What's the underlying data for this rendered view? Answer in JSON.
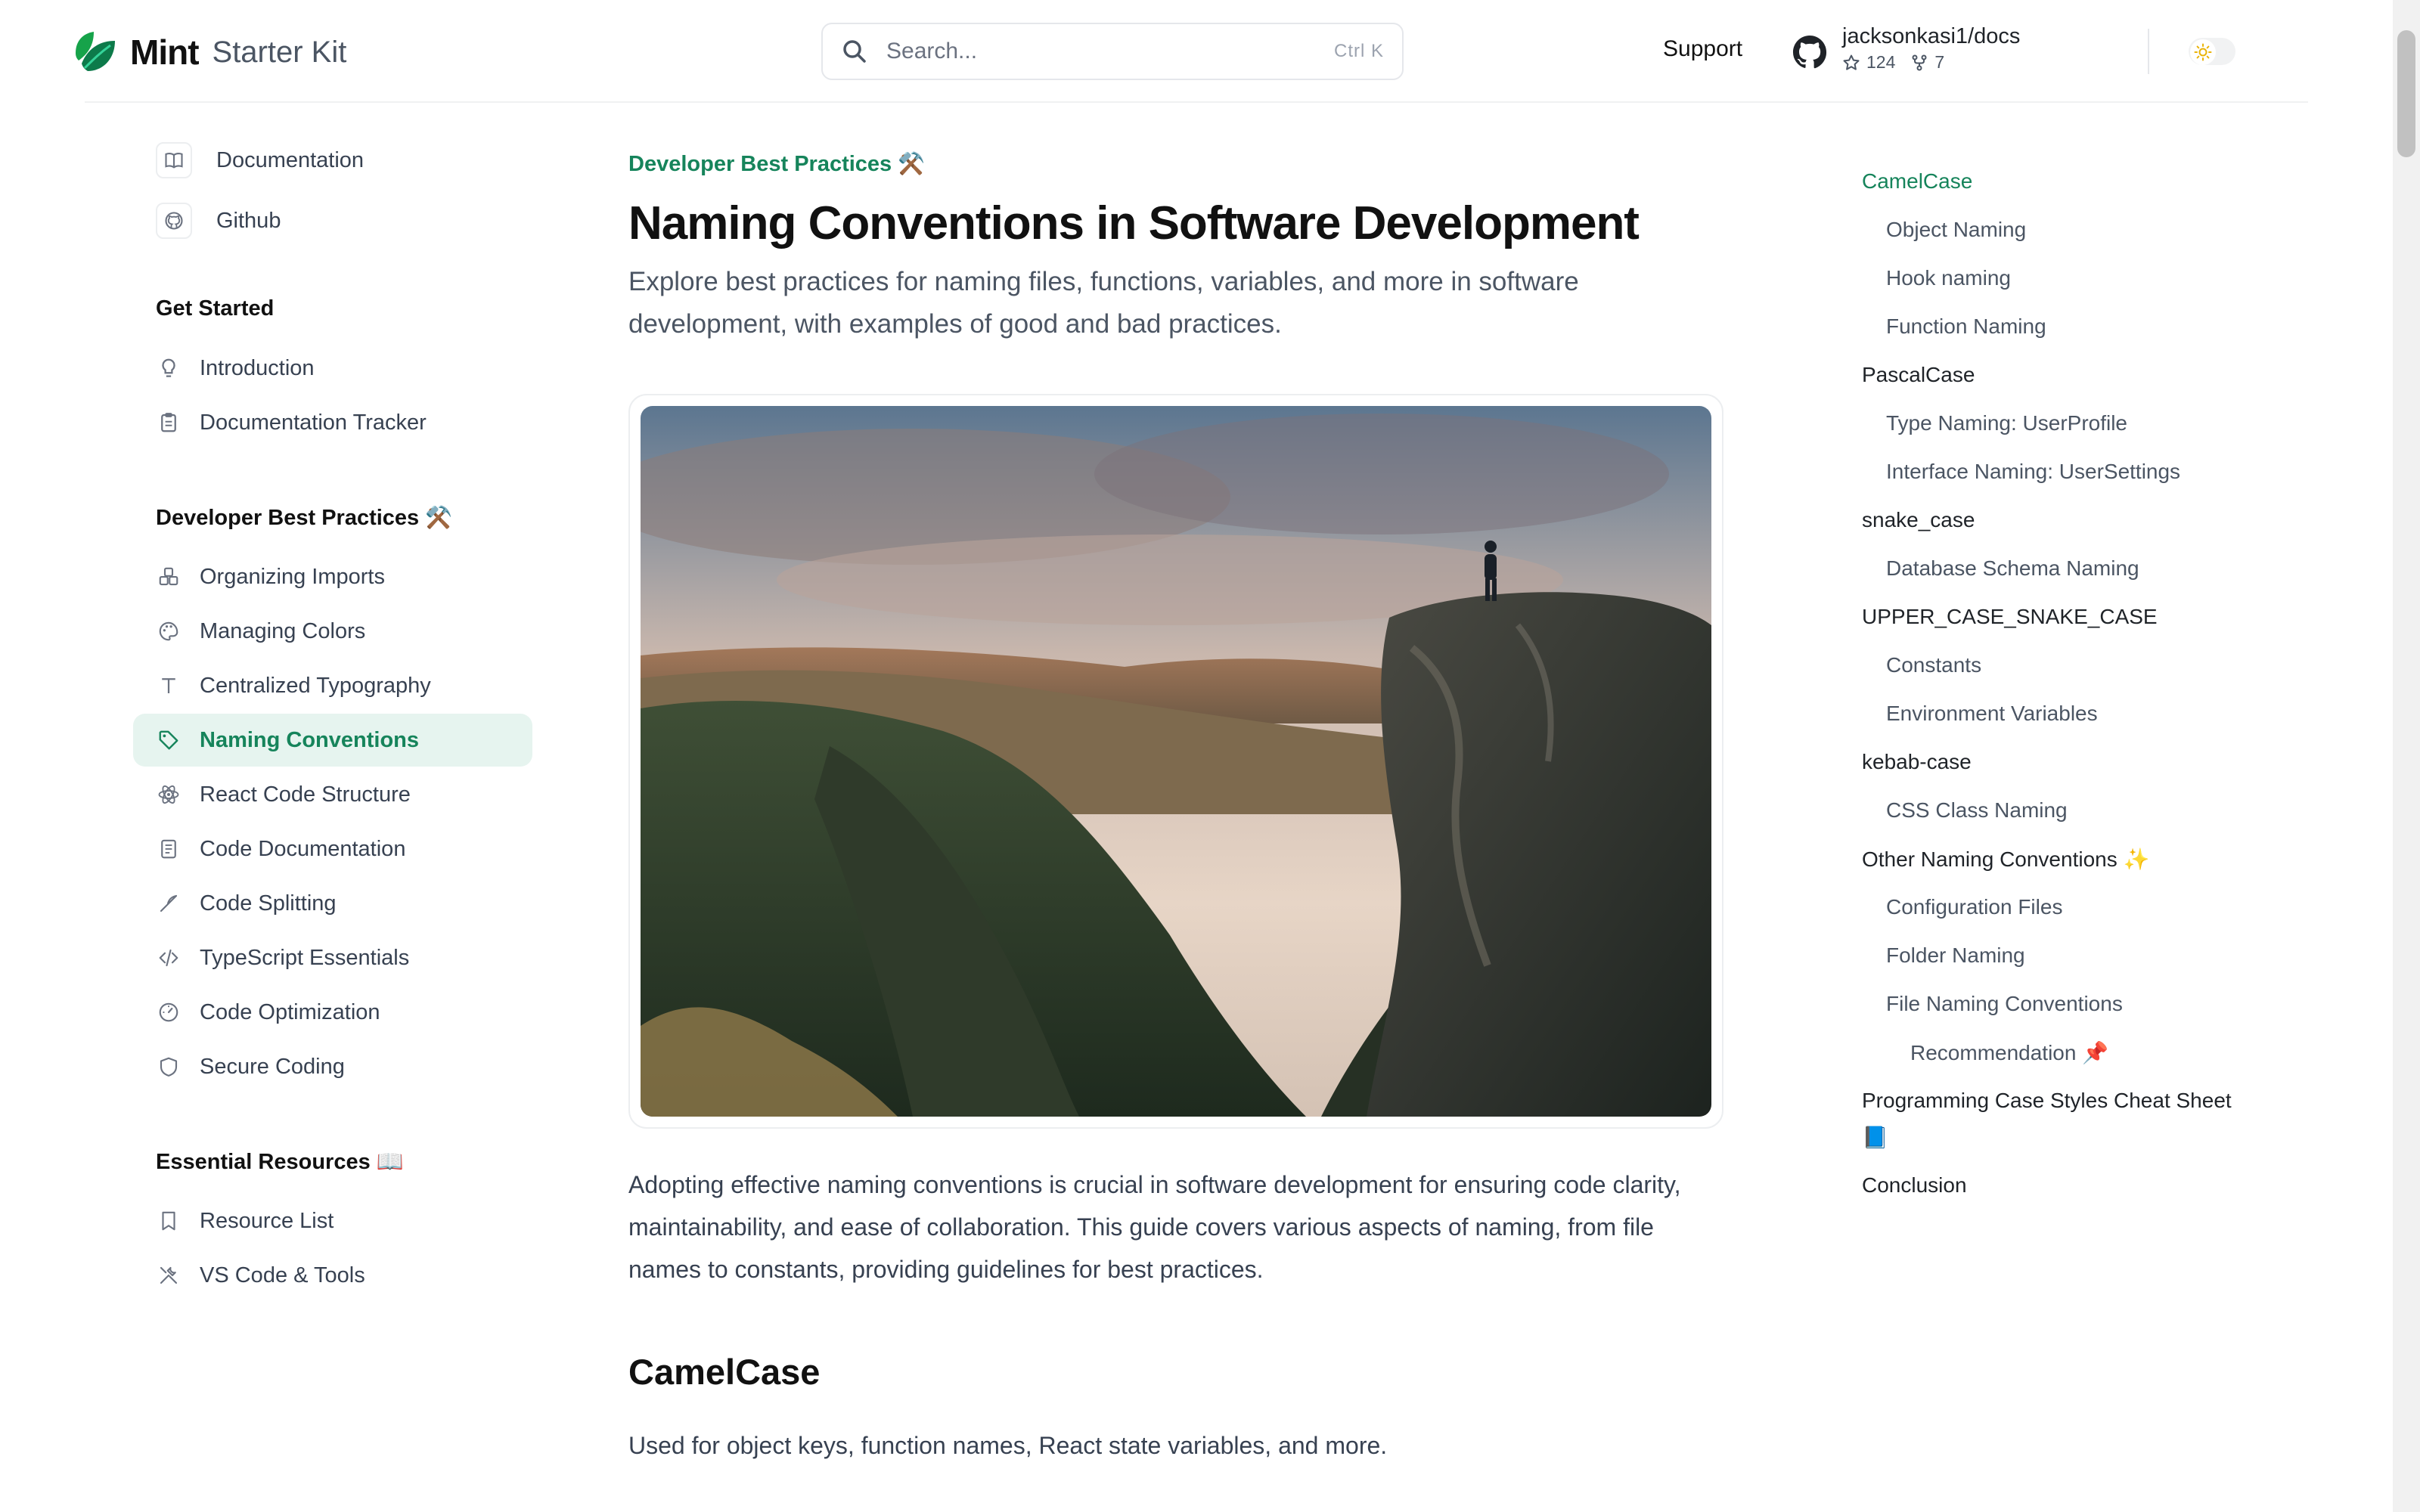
{
  "header": {
    "brand": "Mint",
    "brand_sub": "Starter Kit",
    "search_placeholder": "Search...",
    "search_shortcut": "Ctrl K",
    "support_label": "Support",
    "repo_name": "jacksonkasi1/docs",
    "repo_stars": "124",
    "repo_forks": "7"
  },
  "sidebar": {
    "top_links": [
      {
        "label": "Documentation",
        "icon": "book-icon"
      },
      {
        "label": "Github",
        "icon": "github-icon"
      }
    ],
    "groups": [
      {
        "title": "Get Started",
        "items": [
          {
            "label": "Introduction",
            "icon": "lightbulb-icon"
          },
          {
            "label": "Documentation Tracker",
            "icon": "clipboard-icon"
          }
        ]
      },
      {
        "title": "Developer Best Practices ⚒️",
        "items": [
          {
            "label": "Organizing Imports",
            "icon": "boxes-icon"
          },
          {
            "label": "Managing Colors",
            "icon": "palette-icon"
          },
          {
            "label": "Centralized Typography",
            "icon": "type-icon"
          },
          {
            "label": "Naming Conventions",
            "icon": "tag-icon",
            "active": true
          },
          {
            "label": "React Code Structure",
            "icon": "react-icon"
          },
          {
            "label": "Code Documentation",
            "icon": "document-icon"
          },
          {
            "label": "Code Splitting",
            "icon": "split-icon"
          },
          {
            "label": "TypeScript Essentials",
            "icon": "code-icon"
          },
          {
            "label": "Code Optimization",
            "icon": "gauge-icon"
          },
          {
            "label": "Secure Coding",
            "icon": "shield-icon"
          }
        ]
      },
      {
        "title": "Essential Resources 📖",
        "items": [
          {
            "label": "Resource List",
            "icon": "bookmark-icon"
          },
          {
            "label": "VS Code & Tools",
            "icon": "tools-icon"
          }
        ]
      }
    ]
  },
  "main": {
    "eyebrow": "Developer Best Practices ⚒️",
    "title": "Naming Conventions in Software Development",
    "description": "Explore best practices for naming files, functions, variables, and more in software development, with examples of good and bad practices.",
    "intro": "Adopting effective naming conventions is crucial in software development for ensuring code clarity, maintainability, and ease of collaboration. This guide covers various aspects of naming, from file names to constants, providing guidelines for best practices.",
    "section_title": "CamelCase",
    "section_text": "Used for object keys, function names, React state variables, and more."
  },
  "toc": [
    {
      "label": "CamelCase",
      "level": 1,
      "active": true
    },
    {
      "label": "Object Naming",
      "level": 2
    },
    {
      "label": "Hook naming",
      "level": 2
    },
    {
      "label": "Function Naming",
      "level": 2
    },
    {
      "label": "PascalCase",
      "level": 1
    },
    {
      "label": "Type Naming:  UserProfile",
      "level": 2
    },
    {
      "label": "Interface Naming: UserSettings",
      "level": 2
    },
    {
      "label": "snake_case",
      "level": 1
    },
    {
      "label": "Database Schema Naming",
      "level": 2
    },
    {
      "label": "UPPER_CASE_SNAKE_CASE",
      "level": 1
    },
    {
      "label": "Constants",
      "level": 2
    },
    {
      "label": "Environment Variables",
      "level": 2
    },
    {
      "label": "kebab-case",
      "level": 1
    },
    {
      "label": "CSS Class Naming",
      "level": 2
    },
    {
      "label": "Other Naming Conventions ✨",
      "level": 1
    },
    {
      "label": "Configuration Files",
      "level": 2
    },
    {
      "label": "Folder Naming",
      "level": 2
    },
    {
      "label": "File Naming Conventions",
      "level": 2
    },
    {
      "label": "Recommendation 📌",
      "level": 3
    },
    {
      "label": "Programming Case Styles Cheat Sheet",
      "level": 1
    },
    {
      "label": "📘",
      "level": 1
    },
    {
      "label": "Conclusion",
      "level": 1
    }
  ],
  "colors": {
    "accent": "#16845b",
    "active_bg": "#e6f4ef"
  }
}
